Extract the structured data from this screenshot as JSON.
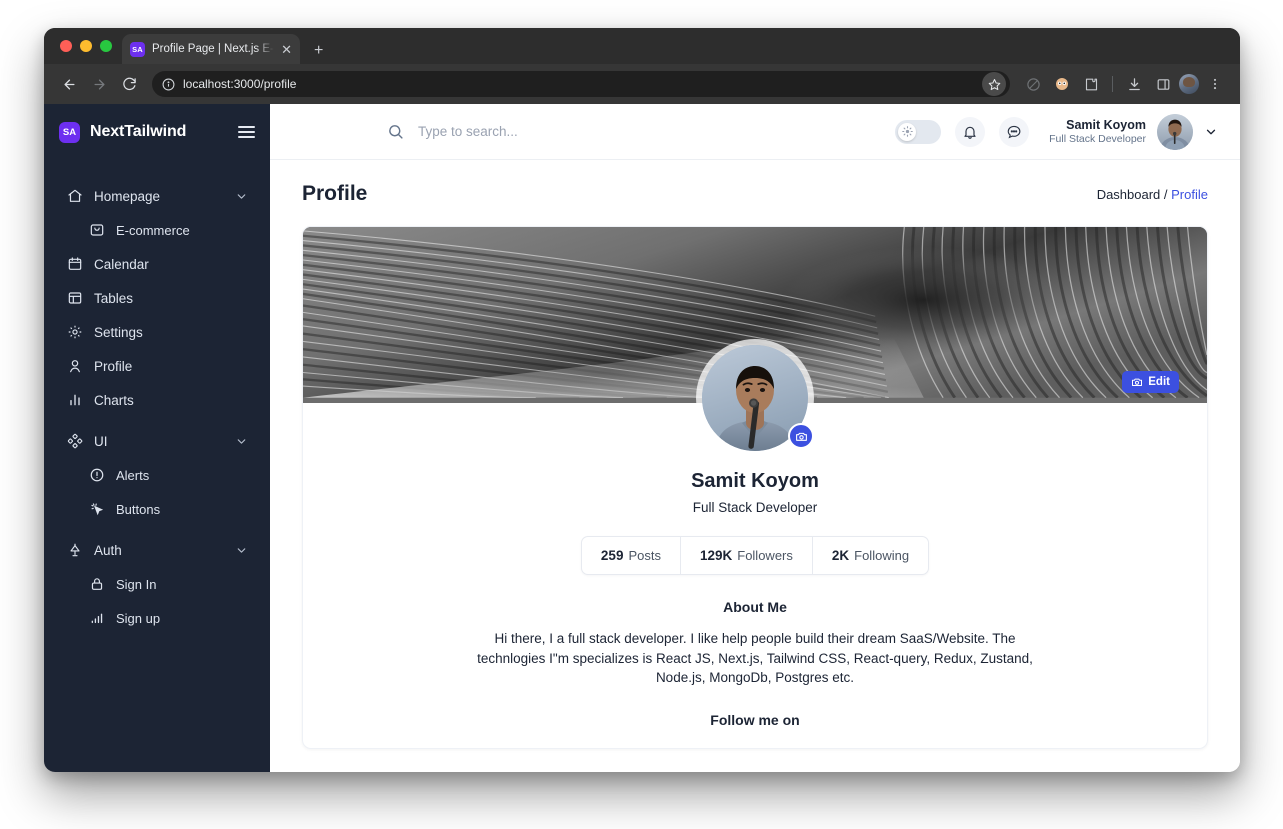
{
  "browser": {
    "tab": {
      "favicon_text": "SA",
      "title": "Profile Page | Next.js E-comm",
      "close_label": "✕"
    },
    "new_tab_label": "+",
    "address": "localhost:3000/profile",
    "icons": {
      "back": "back-arrow-icon",
      "forward": "forward-arrow-icon",
      "reload": "reload-icon",
      "site_info": "site-info-icon",
      "bookmark": "star-icon",
      "history": "history-off-icon",
      "extension_face": "extension-icon",
      "extensions": "puzzle-icon",
      "downloads": "download-icon",
      "side_panel": "side-panel-icon",
      "profile": "browser-profile-avatar",
      "menu": "kebab-menu-icon"
    }
  },
  "sidebar": {
    "brand": {
      "mark": "SA",
      "name": "NextTailwind"
    },
    "menu_toggle": "hamburger-icon",
    "items": [
      {
        "label": "Homepage",
        "icon": "home-icon",
        "expandable": true,
        "sub": false
      },
      {
        "label": "E-commerce",
        "icon": "shopping-bag-icon",
        "expandable": false,
        "sub": true
      },
      {
        "label": "Calendar",
        "icon": "calendar-icon",
        "expandable": false,
        "sub": false
      },
      {
        "label": "Tables",
        "icon": "table-icon",
        "expandable": false,
        "sub": false
      },
      {
        "label": "Settings",
        "icon": "gear-icon",
        "expandable": false,
        "sub": false
      },
      {
        "label": "Profile",
        "icon": "user-icon",
        "expandable": false,
        "sub": false
      },
      {
        "label": "Charts",
        "icon": "bar-chart-icon",
        "expandable": false,
        "sub": false
      },
      {
        "label": "UI",
        "icon": "shapes-icon",
        "expandable": true,
        "sub": false
      },
      {
        "label": "Alerts",
        "icon": "alert-circle-icon",
        "expandable": false,
        "sub": true
      },
      {
        "label": "Buttons",
        "icon": "cursor-click-icon",
        "expandable": false,
        "sub": true
      },
      {
        "label": "Auth",
        "icon": "auth-lamp-icon",
        "expandable": true,
        "sub": false
      },
      {
        "label": "Sign In",
        "icon": "lock-icon",
        "expandable": false,
        "sub": true
      },
      {
        "label": "Sign up",
        "icon": "signal-bars-icon",
        "expandable": false,
        "sub": true
      }
    ]
  },
  "topbar": {
    "search": {
      "placeholder": "Type to search...",
      "value": "",
      "icon": "search-icon"
    },
    "theme_toggle": {
      "state": "light",
      "icon": "sun-icon"
    },
    "notifications_icon": "bell-icon",
    "messages_icon": "chat-bubble-icon",
    "user": {
      "name": "Samit Koyom",
      "role": "Full Stack Developer",
      "avatar": "user-avatar"
    },
    "dropdown_icon": "chevron-down-icon"
  },
  "page": {
    "title": "Profile",
    "breadcrumb": {
      "parent": "Dashboard /",
      "current": "Profile"
    }
  },
  "profile": {
    "cover": {
      "edit_label": "Edit",
      "edit_icon": "camera-icon"
    },
    "avatar_edit_icon": "camera-icon",
    "name": "Samit Koyom",
    "role": "Full Stack Developer",
    "stats": [
      {
        "num": "259",
        "label": "Posts"
      },
      {
        "num": "129K",
        "label": "Followers"
      },
      {
        "num": "2K",
        "label": "Following"
      }
    ],
    "about_title": "About Me",
    "about_text": "Hi there, I a full stack developer. I like help people build their dream SaaS/Website. The technlogies I\"m specializes is React JS, Next.js, Tailwind CSS, React-query, Redux, Zustand, Node.js, MongoDb, Postgres etc.",
    "follow_title": "Follow me on"
  },
  "colors": {
    "sidebar_bg": "#1c2434",
    "accent": "#3c50e0",
    "brand_purple": "#6d2ff0",
    "text_dark": "#1c2434"
  }
}
